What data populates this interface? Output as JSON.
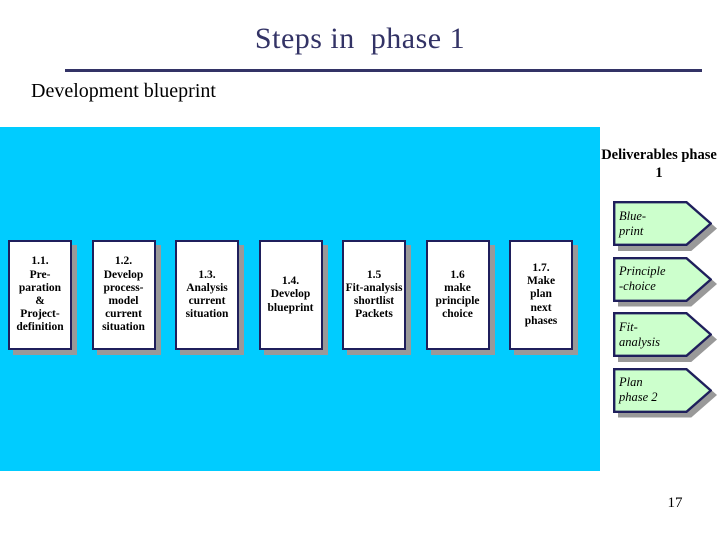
{
  "slide": {
    "title": "Steps in  phase 1",
    "subtitle": "Development blueprint",
    "page_number": "17",
    "colors": {
      "title_navy": "#333366",
      "panel_cyan": "#00ccff",
      "box_border_navy": "#1f1f5c",
      "box_fill_white": "#ffffff",
      "arrow_fill_green": "#ccffcc",
      "shadow_gray": "#999999"
    }
  },
  "deliverables": {
    "heading": "Deliverables\nphase 1",
    "items": [
      {
        "label": "Blue-\nprint"
      },
      {
        "label": "Principle\n-choice"
      },
      {
        "label": "Fit-\nanalysis"
      },
      {
        "label": "Plan\nphase 2"
      }
    ]
  },
  "process": {
    "steps": [
      {
        "label": "1.1.\nPre-\nparation\n&\nProject-\ndefinition"
      },
      {
        "label": "1.2.\nDevelop\nprocess-\nmodel\ncurrent\nsituation"
      },
      {
        "label": "1.3.\nAnalysis\ncurrent\nsituation"
      },
      {
        "label": "1.4.\nDevelop\nblueprint"
      },
      {
        "label": "1.5\nFit-analysis\nshortlist\nPackets"
      },
      {
        "label": "1.6\nmake\nprinciple\nchoice"
      },
      {
        "label": "1.7.\nMake\nplan\nnext\nphases"
      }
    ]
  }
}
